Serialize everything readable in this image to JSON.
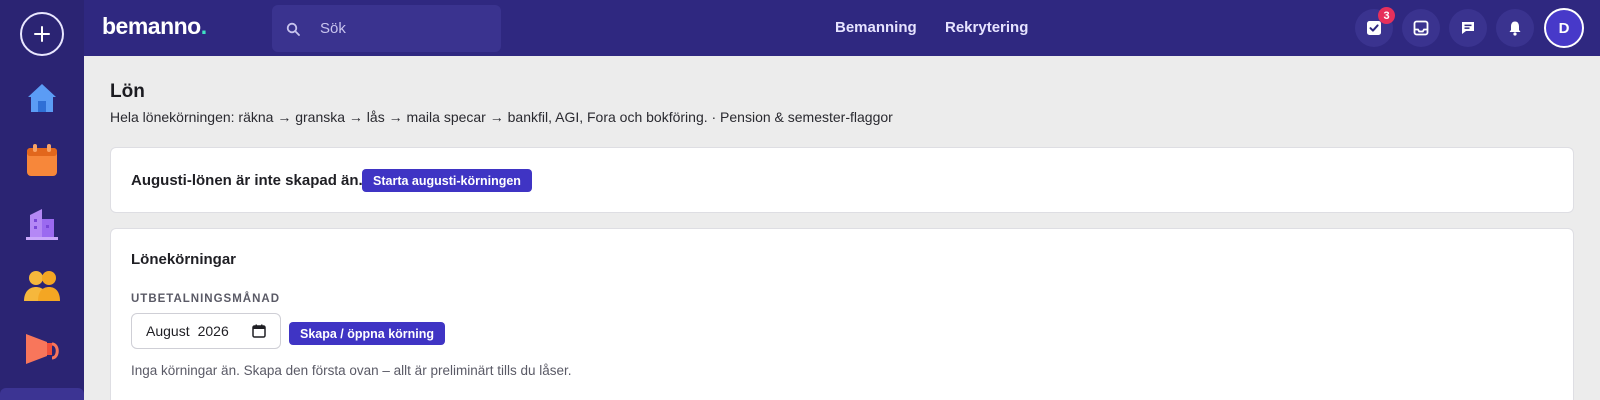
{
  "brand": {
    "name": "bemanno",
    "dot": "."
  },
  "search": {
    "placeholder": "Sök"
  },
  "nav": {
    "items": [
      {
        "label": "Bemanning"
      },
      {
        "label": "Rekrytering"
      }
    ]
  },
  "topbar": {
    "tasks_badge": "3",
    "avatar_initial": "D"
  },
  "page": {
    "title": "Lön",
    "subtitle": "Hela lönekörningen: räkna → granska → lås → maila specar → bankfil, AGI, Fora och bokföring. · Pension & semester-flaggor"
  },
  "notice_card": {
    "text": "Augusti-lönen är inte skapad än.",
    "button_label": "Starta augusti-körningen"
  },
  "runs_card": {
    "title": "Lönekörningar",
    "field_label": "UTBETALNINGSMÅNAD",
    "month_value": "August",
    "year_value": "2026",
    "button_label": "Skapa / öppna körning",
    "empty_text": "Inga körningar än. Skapa den första ovan – allt är preliminärt tills du låser."
  },
  "colors": {
    "sidebar": "#2b2473",
    "topbar": "#2f2880",
    "primary": "#3f34c4",
    "badge": "#e6305b",
    "logo_dot": "#3ee3c4"
  }
}
